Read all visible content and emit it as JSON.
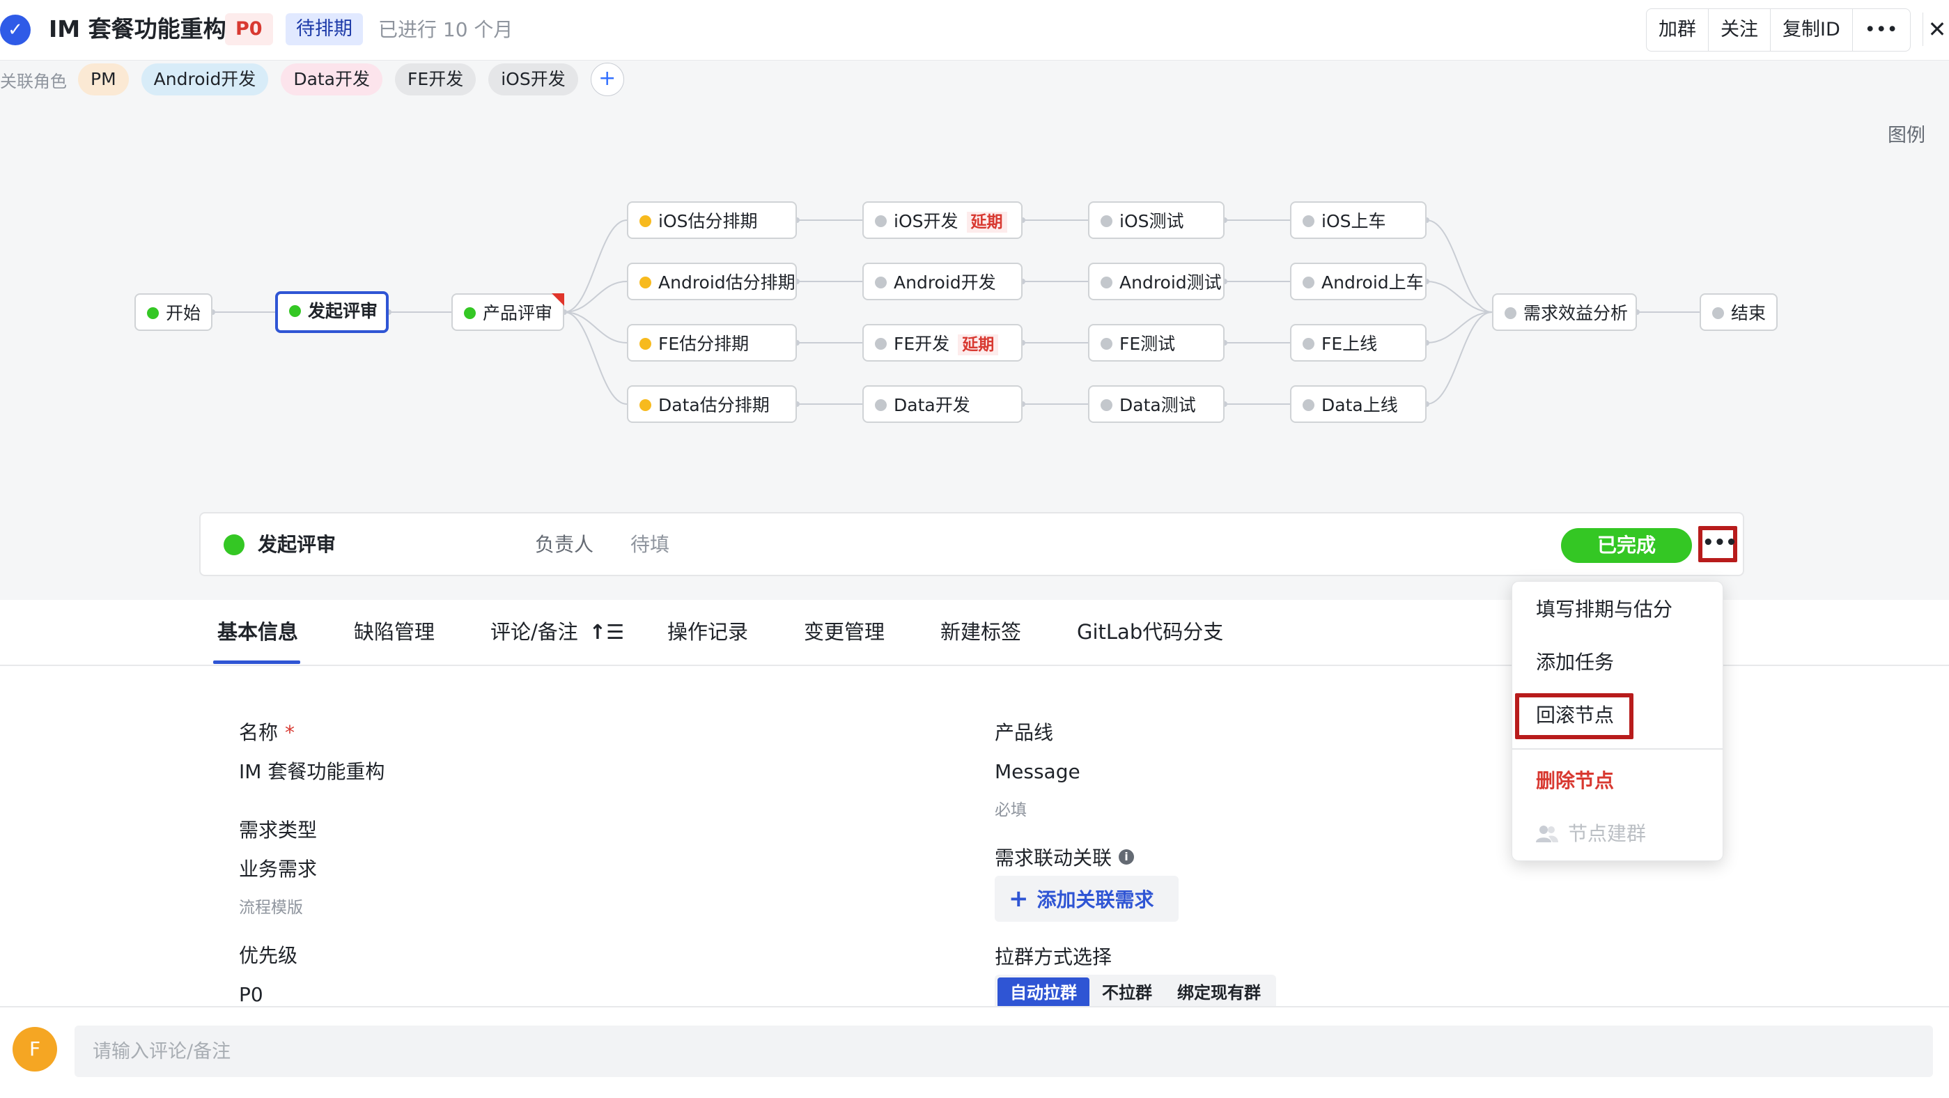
{
  "header": {
    "title": "IM 套餐功能重构",
    "priority": "P0",
    "state": "待排期",
    "elapsed": "已进行 10 个月",
    "actions": [
      "加群",
      "关注",
      "复制ID",
      "•••"
    ],
    "close_icon": "close-icon"
  },
  "roles": {
    "label": "关联角色",
    "items": [
      {
        "label": "PM",
        "color": "#fbe9d4"
      },
      {
        "label": "Android开发",
        "color": "#d8ecf8"
      },
      {
        "label": "Data开发",
        "color": "#fce4ec"
      },
      {
        "label": "FE开发",
        "color": "#e5e6e8"
      },
      {
        "label": "iOS开发",
        "color": "#e5e6e8"
      }
    ],
    "add": "+"
  },
  "legend": "图例",
  "flow": {
    "start": "开始",
    "review_start": "发起评审",
    "product_review": "产品评审",
    "estimate": [
      "iOS估分排期",
      "Android估分排期",
      "FE估分排期",
      "Data估分排期"
    ],
    "develop": [
      "iOS开发",
      "Android开发",
      "FE开发",
      "Data开发"
    ],
    "test": [
      "iOS测试",
      "Android测试",
      "FE测试",
      "Data测试"
    ],
    "release": [
      "iOS上车",
      "Android上车",
      "FE上线",
      "Data上线"
    ],
    "delay_tag": "延期",
    "analysis": "需求效益分析",
    "end": "结束"
  },
  "node_panel": {
    "name": "发起评审",
    "owner_label": "负责人",
    "owner_value": "待填",
    "done_button": "已完成",
    "more_button": "•••"
  },
  "dropdown": {
    "items": [
      "填写排期与估分",
      "添加任务",
      "回滚节点"
    ],
    "danger": "删除节点",
    "disabled": "节点建群"
  },
  "tabs": [
    "基本信息",
    "缺陷管理",
    "评论/备注",
    "操作记录",
    "变更管理",
    "新建标签",
    "GitLab代码分支"
  ],
  "form": {
    "name_label": "名称",
    "required_mark": "*",
    "name_value": "IM 套餐功能重构",
    "type_label": "需求类型",
    "type_value": "业务需求",
    "type_hint": "流程模版",
    "priority_label": "优先级",
    "priority_value": "P0",
    "product_line_label": "产品线",
    "product_line_value": "Message",
    "product_line_hint": "必填",
    "linked_label": "需求联动关联",
    "info_icon": "i",
    "add_linked": "添加关联需求",
    "group_label": "拉群方式选择",
    "group_options": [
      "自动拉群",
      "不拉群",
      "绑定现有群"
    ]
  },
  "comment": {
    "avatar_letter": "F",
    "placeholder": "请输入评论/备注"
  },
  "colors": {
    "accent": "#2f55d4",
    "done_green": "#34c724",
    "estimate_dot": "#f7ba1e",
    "danger": "#d83931",
    "highlight_box": "#b81c1c"
  }
}
